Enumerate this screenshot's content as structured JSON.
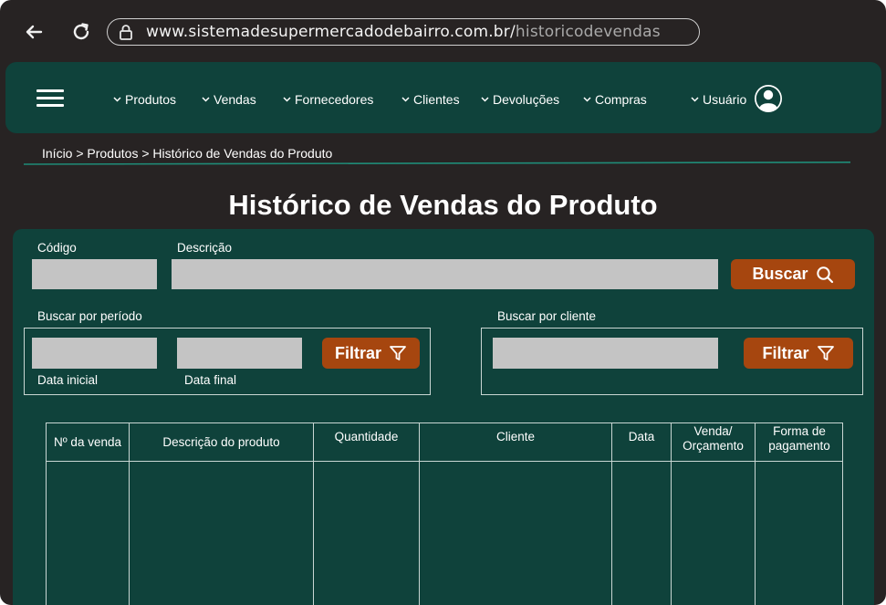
{
  "browser": {
    "url_host": "www.sistemadesupermercadodebairro.com.br/",
    "url_path": "historicodevendas"
  },
  "nav": {
    "items": [
      {
        "label": "Produtos"
      },
      {
        "label": "Vendas"
      },
      {
        "label": "Fornecedores"
      },
      {
        "label": "Clientes"
      },
      {
        "label": "Devoluções"
      },
      {
        "label": "Compras"
      }
    ],
    "user_label": "Usuário"
  },
  "breadcrumb": "Início > Produtos > Histórico de Vendas do Produto",
  "page_title": "Histórico de Vendas do Produto",
  "search": {
    "code_label": "Código",
    "code_value": "",
    "description_label": "Descrição",
    "description_value": "",
    "button_label": "Buscar"
  },
  "period_filter": {
    "label": "Buscar por período",
    "start_label": "Data inicial",
    "start_value": "",
    "end_label": "Data final",
    "end_value": "",
    "button_label": "Filtrar"
  },
  "client_filter": {
    "label": "Buscar por cliente",
    "client_value": "",
    "button_label": "Filtrar"
  },
  "table": {
    "columns": [
      {
        "line1": "Nº da venda",
        "line2": ""
      },
      {
        "line1": "Descrição do produto",
        "line2": ""
      },
      {
        "line1": "Quantidade",
        "line2": ""
      },
      {
        "line1": "Cliente",
        "line2": ""
      },
      {
        "line1": "Data",
        "line2": ""
      },
      {
        "line1": "Venda/",
        "line2": "Orçamento"
      },
      {
        "line1": "Forma de",
        "line2": "pagamento"
      }
    ],
    "rows": []
  },
  "colors": {
    "background": "#272323",
    "primary": "#0f423b",
    "accent": "#a6460f",
    "field": "#c4c4c4",
    "breadcrumb_line": "#1f8c78"
  },
  "icons": [
    "back-arrow-icon",
    "reload-icon",
    "lock-icon",
    "menu-icon",
    "chevron-down-icon",
    "user-avatar-icon",
    "search-icon",
    "filter-icon"
  ]
}
